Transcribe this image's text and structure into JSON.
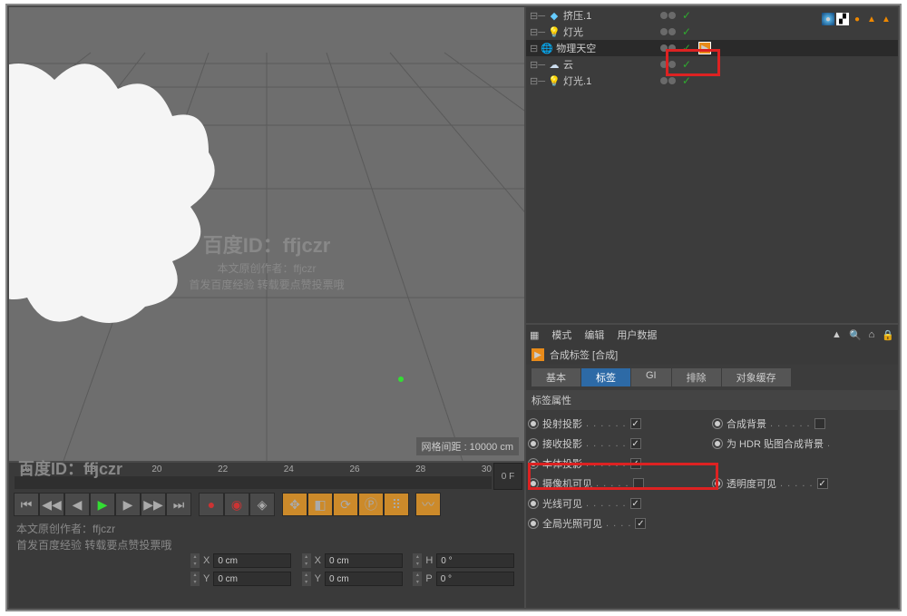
{
  "viewport": {
    "hud": "网格间距 : 10000 cm"
  },
  "watermarks": {
    "title": "百度ID：ffjczr",
    "line1": "本文原创作者：ffjczr",
    "line2": "首发百度经验 转载要点赞投票哦"
  },
  "objects": {
    "items": [
      {
        "name": "挤压.1",
        "icon": "extrude",
        "indent": 1
      },
      {
        "name": "灯光",
        "icon": "light",
        "indent": 1
      },
      {
        "name": "物理天空",
        "icon": "sky",
        "indent": 0,
        "highlight": true
      },
      {
        "name": "云",
        "icon": "cloud",
        "indent": 1
      },
      {
        "name": "灯光.1",
        "icon": "light",
        "indent": 1
      }
    ],
    "top_tags": [
      "sphere",
      "checker",
      "orange-dot",
      "orange-tri",
      "orange-tri"
    ]
  },
  "attr": {
    "menubar": [
      "模式",
      "编辑",
      "用户数据"
    ],
    "title": "合成标签 [合成]",
    "tabs": [
      "基本",
      "标签",
      "GI",
      "排除",
      "对象缓存"
    ],
    "active_tab": 1,
    "section": "标签属性",
    "props": [
      [
        {
          "label": "投射投影",
          "checked": true
        },
        {
          "label": "合成背景",
          "checked": false
        }
      ],
      [
        {
          "label": "接收投影",
          "checked": true
        },
        {
          "label": "为 HDR 贴图合成背景",
          "checked": false,
          "nocb": true
        }
      ],
      [
        {
          "label": "本体投影",
          "checked": true
        },
        null
      ],
      [
        {
          "label": "摄像机可见",
          "checked": false,
          "hl": true
        },
        {
          "label": "透明度可见",
          "checked": true
        }
      ],
      [
        {
          "label": "光线可见",
          "checked": true
        },
        null
      ],
      [
        {
          "label": "全局光照可见",
          "checked": true
        },
        null
      ]
    ]
  },
  "timeline": {
    "ticks": [
      "16",
      "18",
      "20",
      "22",
      "24",
      "26",
      "28",
      "30"
    ],
    "frame": "0 F"
  },
  "coords": {
    "rows": [
      [
        {
          "axis": "X",
          "val": "0 cm"
        },
        {
          "axis": "X",
          "val": "0 cm"
        },
        {
          "axis": "H",
          "val": "0 °"
        }
      ],
      [
        {
          "axis": "Y",
          "val": "0 cm"
        },
        {
          "axis": "Y",
          "val": "0 cm"
        },
        {
          "axis": "P",
          "val": "0 °"
        }
      ]
    ]
  }
}
